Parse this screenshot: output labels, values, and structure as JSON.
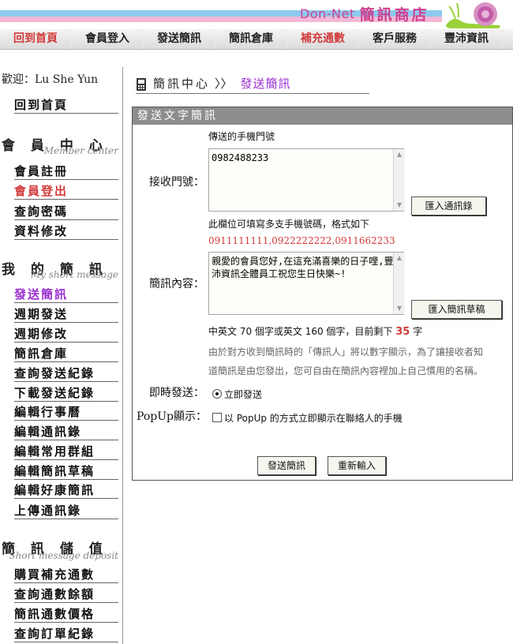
{
  "brand": {
    "name_en": "Don-Net",
    "name_zh": "簡訊商店"
  },
  "nav": {
    "items": [
      {
        "label": "回到首頁"
      },
      {
        "label": "會員登入"
      },
      {
        "label": "發送簡訊"
      },
      {
        "label": "簡訊倉庫"
      },
      {
        "label": "補充通數"
      },
      {
        "label": "客戶服務"
      },
      {
        "label": "豐沛資訊"
      }
    ]
  },
  "sidebar": {
    "welcome": "歡迎：Lu She Yun",
    "home_link": "回到首頁",
    "member_center": {
      "title": "會 員 中 心",
      "subtitle": "Member center",
      "items": [
        "會員註冊",
        "會員登出",
        "查詢密碼",
        "資料修改"
      ]
    },
    "my_sms": {
      "title": "我 的 簡 訊",
      "subtitle": "My short message",
      "items": [
        "發送簡訊",
        "週期發送",
        "週期修改",
        "簡訊倉庫",
        "查詢發送紀錄",
        "下載發送紀錄",
        "編輯行事曆",
        "編輯通訊錄",
        "編輯常用群組",
        "編輯簡訊草稿",
        "編輯好康簡訊",
        "上傳通訊錄"
      ]
    },
    "deposit": {
      "title": "簡 訊 儲 值",
      "subtitle": "Short message deposit",
      "items": [
        "購買補充通數",
        "查詢通數餘額",
        "簡訊通數價格",
        "查詢訂單紀錄"
      ]
    }
  },
  "breadcrumb": {
    "title": "簡訊中心",
    "separator": "〉〉",
    "current": "發送簡訊"
  },
  "form": {
    "panel_title": "發送文字簡訊",
    "phone_hint": "傳送的手機門號",
    "recipients_label": "接收門號：",
    "recipients_value": "0982488233",
    "import_contacts_button": "匯入通訊錄",
    "format_hint": "此欄位可填寫多支手機號碼，格式如下",
    "format_example": "0911111111,0922222222,0911662233",
    "content_label": "簡訊內容：",
    "content_value": "親愛的會員您好,在這充滿喜樂的日子哩,豐沛資訊全體員工祝您生日快樂~!",
    "import_draft_button": "匯入簡訊草稿",
    "count_prefix": "中英文 70 個字或英文 160 個字，目前剩下",
    "count_remaining": "35",
    "count_suffix": "字",
    "sender_note_1": "由於對方收到簡訊時的「傳訊人」將以數字顯示，為了讓接收者知",
    "sender_note_2": "道簡訊是由您發出，您可自由在簡訊內容裡加上自己慣用的名稱。",
    "instant_label": "即時發送：",
    "instant_option": "立即發送",
    "popup_label": "PopUp顯示：",
    "popup_option": "以 PopUp 的方式立即顯示在聯絡人的手機",
    "send_button": "發送簡訊",
    "reset_button": "重新輸入"
  },
  "colors": {
    "accent_red": "#d23b3b",
    "accent_purple": "#9a2fd0",
    "brand_pink": "#d0408f"
  }
}
